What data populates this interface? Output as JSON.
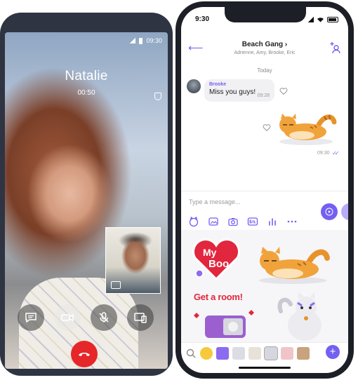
{
  "call_screen": {
    "status_time": "09:30",
    "caller_name": "Natalie",
    "call_duration": "00:50",
    "controls": [
      "message",
      "video",
      "mute",
      "switch-screen",
      "end-call"
    ]
  },
  "chat_screen": {
    "status_time": "9:30",
    "group_title": "Beach Gang ›",
    "group_members": "Adrienne, Amy, Brooke, Eric",
    "date_separator": "Today",
    "incoming_message": {
      "sender": "Brooke",
      "text": "Miss you guys!",
      "time": "09:28"
    },
    "outgoing_sticker_time": "09:30",
    "input_placeholder": "Type a message...",
    "toolbar_icons": [
      "sticker-icon",
      "gif-image-icon",
      "camera-icon",
      "gif-icon",
      "poll-icon",
      "more-icon"
    ],
    "stickers": {
      "my_boo_line1": "My",
      "my_boo_line2": "Boo",
      "get_a_room": "Get a room!"
    },
    "accent_color": "#7360f2"
  }
}
